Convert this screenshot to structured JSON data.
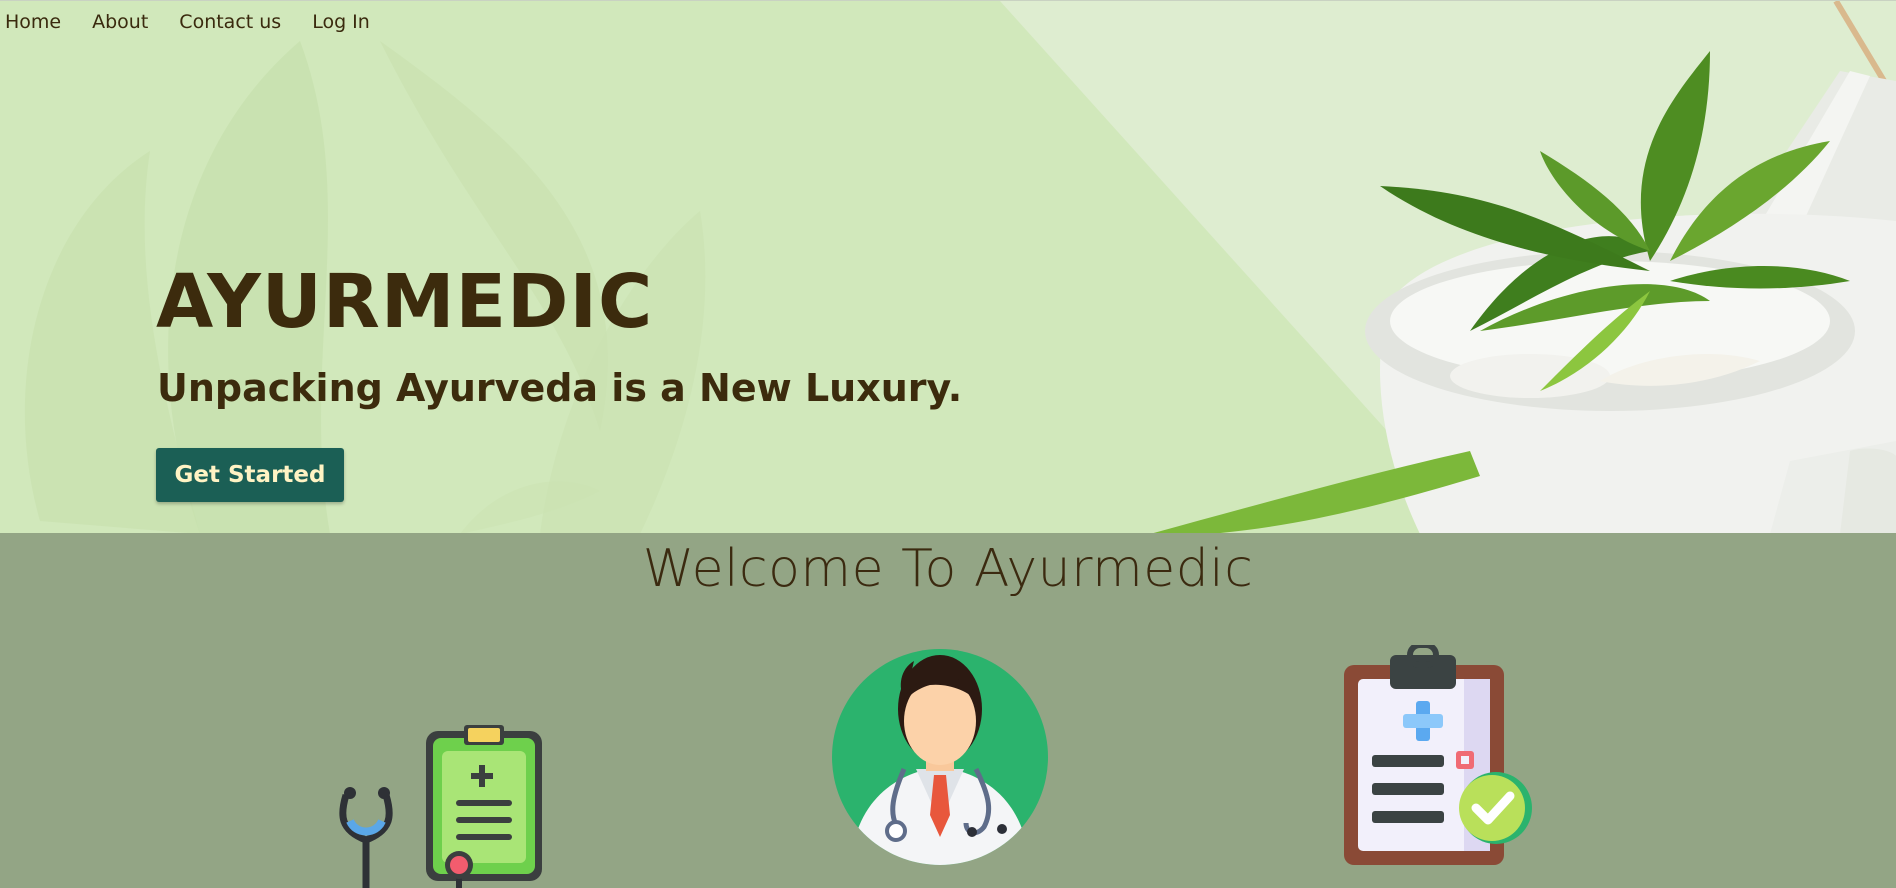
{
  "nav": {
    "items": [
      {
        "label": "Home"
      },
      {
        "label": "About"
      },
      {
        "label": "Contact us"
      },
      {
        "label": "Log In"
      }
    ]
  },
  "hero": {
    "title": "AYURMEDIC",
    "subtitle": "Unpacking Ayurveda is a New Luxury.",
    "cta_label": "Get Started"
  },
  "welcome": {
    "heading": "Welcome To Ayurmedic"
  },
  "features": [
    {
      "icon": "stethoscope-clipboard-icon"
    },
    {
      "icon": "doctor-avatar-icon"
    },
    {
      "icon": "medical-report-icon"
    }
  ],
  "colors": {
    "hero_bg": "#d1e8bb",
    "section_bg": "#93a585",
    "text_dark": "#3c2b0d",
    "button_bg": "#1b5f55",
    "button_text": "#fff3c4"
  }
}
